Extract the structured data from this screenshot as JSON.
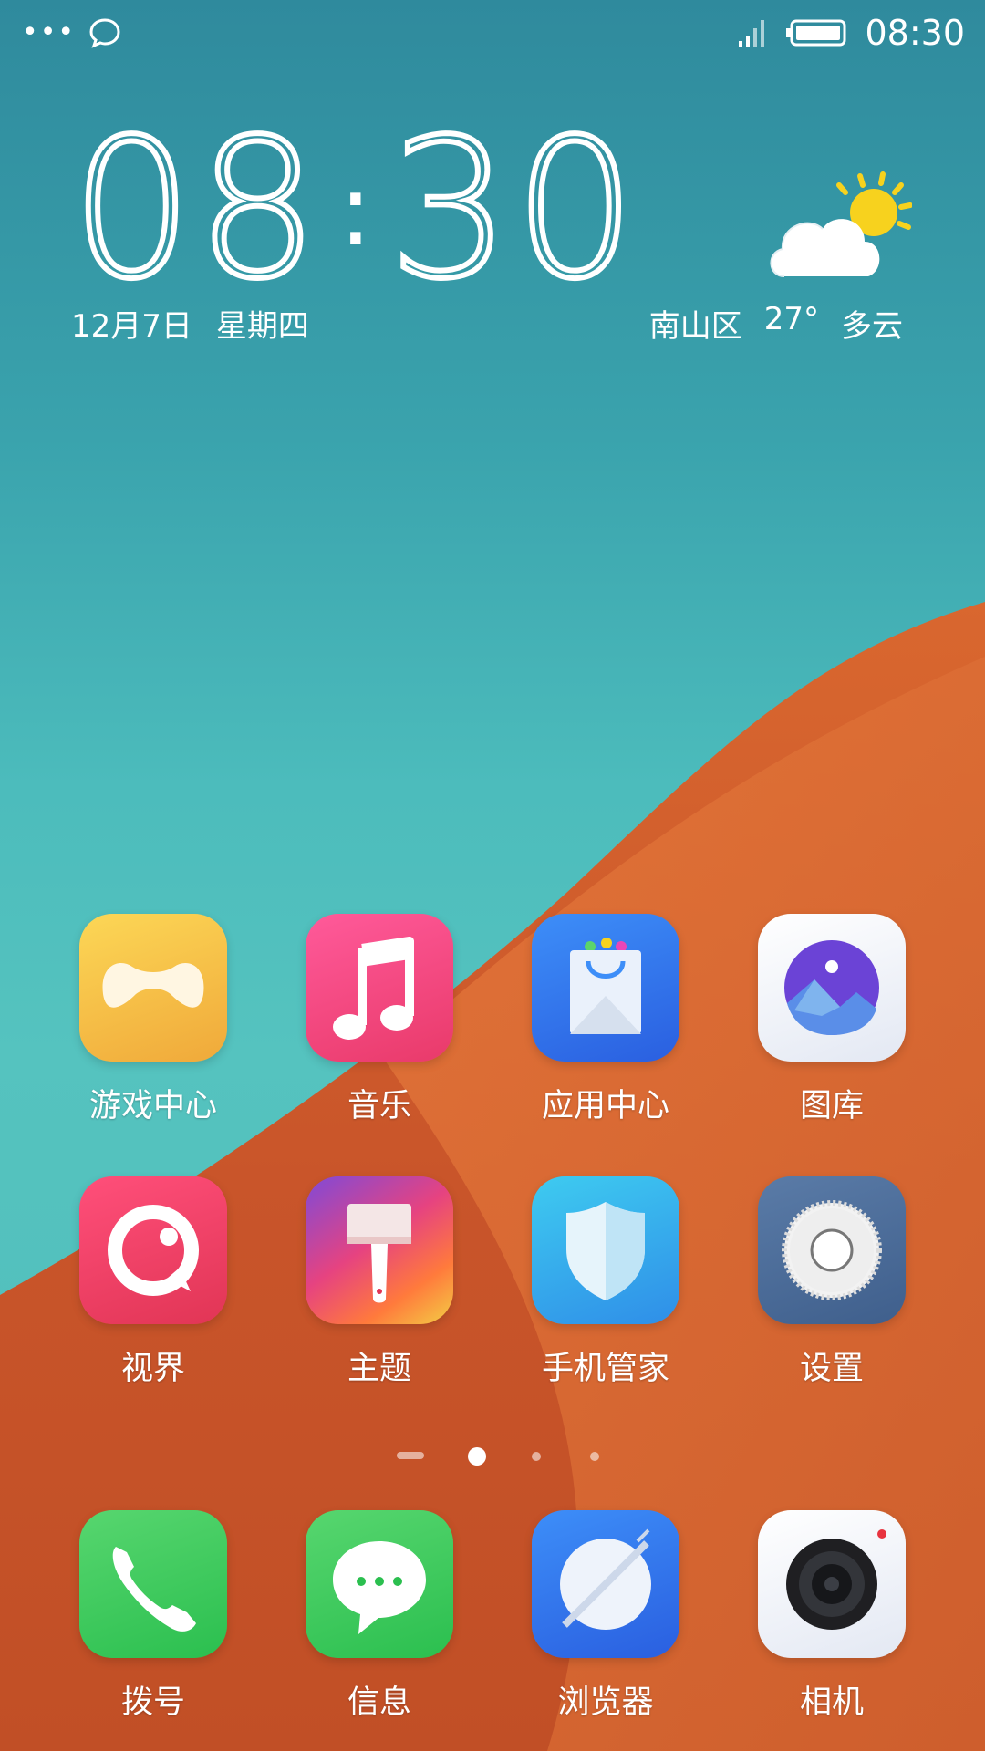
{
  "status_bar": {
    "left_icons": [
      "more-dots-icon",
      "chat-bubble-icon"
    ],
    "right_icons": [
      "signal-icon",
      "battery-icon"
    ],
    "time": "08:30"
  },
  "clock": {
    "hour": "08",
    "minute": "30",
    "date": "12月7日",
    "weekday": "星期四"
  },
  "weather": {
    "icon": "partly-cloudy-icon",
    "district": "南山区",
    "temperature": "27°",
    "condition": "多云"
  },
  "apps": [
    {
      "label": "游戏中心",
      "icon": "game-center-icon"
    },
    {
      "label": "音乐",
      "icon": "music-icon"
    },
    {
      "label": "应用中心",
      "icon": "app-store-icon"
    },
    {
      "label": "图库",
      "icon": "gallery-icon"
    },
    {
      "label": "视界",
      "icon": "video-icon"
    },
    {
      "label": "主题",
      "icon": "theme-brush-icon"
    },
    {
      "label": "手机管家",
      "icon": "phone-manager-shield-icon"
    },
    {
      "label": "设置",
      "icon": "settings-gear-icon"
    }
  ],
  "page_indicator": {
    "pages": 4,
    "current": 2
  },
  "dock": [
    {
      "label": "拨号",
      "icon": "phone-icon"
    },
    {
      "label": "信息",
      "icon": "message-icon"
    },
    {
      "label": "浏览器",
      "icon": "browser-icon"
    },
    {
      "label": "相机",
      "icon": "camera-icon"
    }
  ]
}
